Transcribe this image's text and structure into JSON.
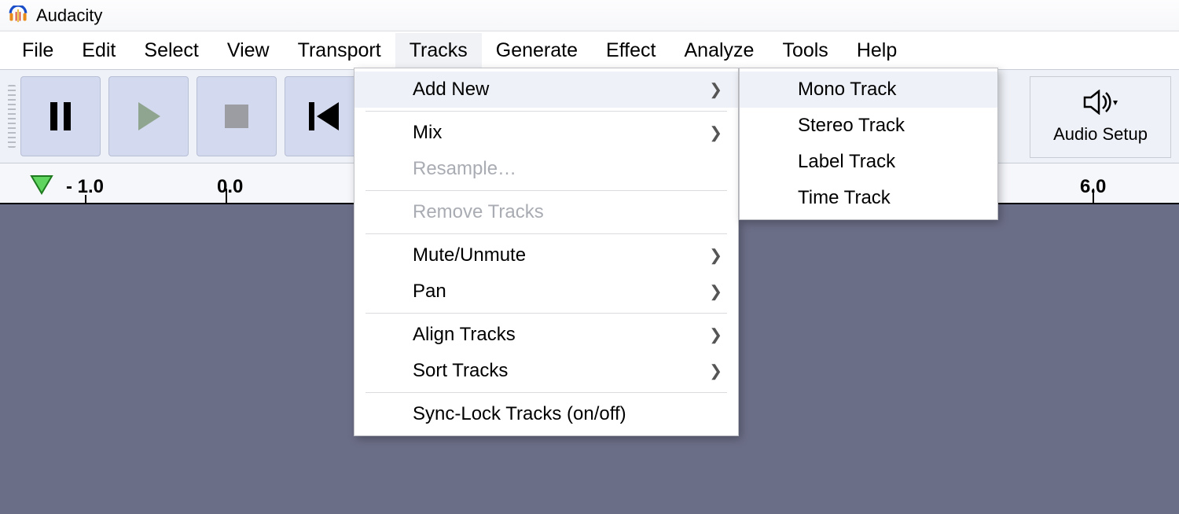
{
  "app": {
    "title": "Audacity"
  },
  "menubar": {
    "file": "File",
    "edit": "Edit",
    "select": "Select",
    "view": "View",
    "transport": "Transport",
    "tracks": "Tracks",
    "generate": "Generate",
    "effect": "Effect",
    "analyze": "Analyze",
    "tools": "Tools",
    "help": "Help"
  },
  "toolbar": {
    "audio_setup": "Audio Setup"
  },
  "ruler": {
    "labels": [
      "- 1.0",
      "0.0",
      "6.0"
    ]
  },
  "tracks_menu": {
    "add_new": "Add New",
    "mix": "Mix",
    "resample": "Resample…",
    "remove_tracks": "Remove Tracks",
    "mute_unmute": "Mute/Unmute",
    "pan": "Pan",
    "align_tracks": "Align Tracks",
    "sort_tracks": "Sort Tracks",
    "sync_lock": "Sync-Lock Tracks (on/off)"
  },
  "add_new_submenu": {
    "mono": "Mono Track",
    "stereo": "Stereo Track",
    "label": "Label Track",
    "time": "Time Track"
  }
}
